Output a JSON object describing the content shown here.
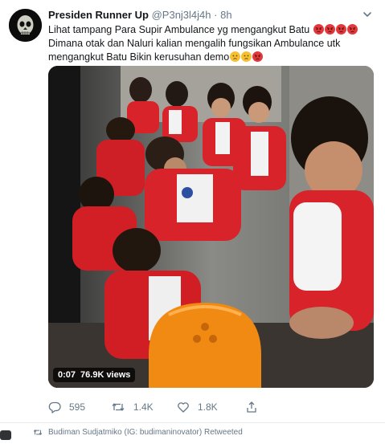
{
  "tweet": {
    "display_name": "Presiden Runner Up",
    "handle": "@P3nj3l4j4h",
    "separator": "·",
    "time": "8h",
    "text_line1": "Lihat tampang Para Supir Ambulance yg mengangkut Batu",
    "text_line2": "Dimana  otak dan Naluri kalian mengalih fungsikan Ambulance utk",
    "text_line3": "mengangkut Batu Bikin kerusuhan demo",
    "emojis_line1": [
      "angry-face-icon",
      "angry-face-icon",
      "angry-face-icon",
      "angry-face-icon"
    ],
    "emojis_line3": [
      "worried-face-icon",
      "worried-face-icon",
      "angry-face-icon"
    ]
  },
  "video": {
    "duration": "0:07",
    "views": "76.9K views"
  },
  "actions": {
    "replies": "595",
    "retweets": "1.4K",
    "likes": "1.8K"
  },
  "retweet_context": {
    "text": "Budiman Sudjatmiko (IG: budimaninovator) Retweeted"
  },
  "colors": {
    "text_primary": "#14171a",
    "text_secondary": "#657786",
    "angry_emoji": "#e0383b",
    "worried_emoji": "#f5c033",
    "uniform_red": "#d8232a",
    "helmet_orange": "#f18a13"
  }
}
